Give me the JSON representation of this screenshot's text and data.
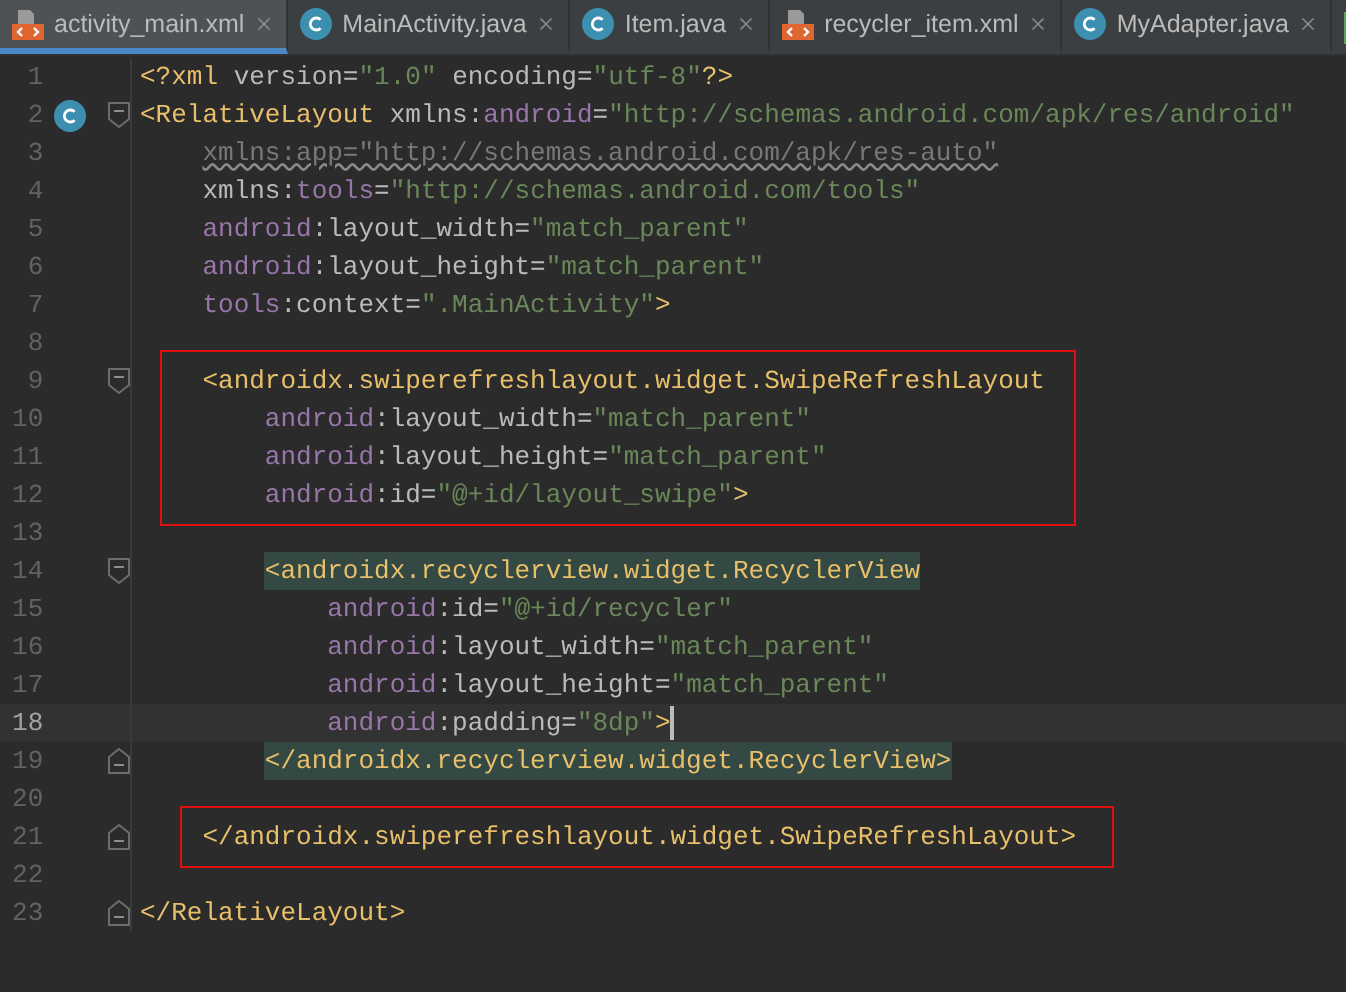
{
  "tabs": [
    {
      "label": "activity_main.xml",
      "kind": "xml",
      "selected": true
    },
    {
      "label": "MainActivity.java",
      "kind": "java",
      "selected": false
    },
    {
      "label": "Item.java",
      "kind": "java",
      "selected": false
    },
    {
      "label": "recycler_item.xml",
      "kind": "xml",
      "selected": false
    },
    {
      "label": "MyAdapter.java",
      "kind": "java",
      "selected": false
    }
  ],
  "editor": {
    "blocks": [
      {
        "kind": "plain",
        "lines": [
          {
            "number": "1",
            "tokens": [
              {
                "kind": "tag",
                "text": "<?xml"
              },
              {
                "kind": "attr",
                "text": " version="
              },
              {
                "kind": "value",
                "text": "\"1.0\""
              },
              {
                "kind": "attr",
                "text": " encoding="
              },
              {
                "kind": "value",
                "text": "\"utf-8\""
              },
              {
                "kind": "tag",
                "text": "?>"
              }
            ]
          },
          {
            "number": "2",
            "class_marker": true,
            "fold_start": true,
            "tokens": [
              {
                "kind": "tag",
                "text": "<RelativeLayout"
              },
              {
                "kind": "attr",
                "text": " xmlns:"
              },
              {
                "kind": "ns",
                "text": "android"
              },
              {
                "kind": "attr",
                "text": "="
              },
              {
                "kind": "value",
                "text": "\"http://schemas.android.com/apk/res/android\""
              }
            ]
          },
          {
            "number": "3",
            "tokens": [
              {
                "kind": "unused",
                "text": "    xmlns:app=\"http://schemas.android.com/apk/res-auto\""
              }
            ]
          },
          {
            "number": "4",
            "tokens": [
              {
                "kind": "attr",
                "text": "    xmlns:"
              },
              {
                "kind": "ns",
                "text": "tools"
              },
              {
                "kind": "attr",
                "text": "="
              },
              {
                "kind": "value",
                "text": "\"http://schemas.android.com/tools\""
              }
            ]
          },
          {
            "number": "5",
            "tokens": [
              {
                "kind": "ns",
                "text": "    android"
              },
              {
                "kind": "attr",
                "text": ":layout_width="
              },
              {
                "kind": "value",
                "text": "\"match_parent\""
              }
            ]
          },
          {
            "number": "6",
            "tokens": [
              {
                "kind": "ns",
                "text": "    android"
              },
              {
                "kind": "attr",
                "text": ":layout_height="
              },
              {
                "kind": "value",
                "text": "\"match_parent\""
              }
            ]
          },
          {
            "number": "7",
            "tokens": [
              {
                "kind": "ns",
                "text": "    tools"
              },
              {
                "kind": "attr",
                "text": ":context="
              },
              {
                "kind": "value",
                "text": "\".MainActivity\""
              },
              {
                "kind": "tag",
                "text": ">"
              }
            ]
          },
          {
            "number": "8"
          }
        ]
      },
      {
        "kind": "framed",
        "lines": [
          {
            "number": "9",
            "fold_start": true,
            "tokens": [
              {
                "kind": "tag",
                "text": "    <androidx.swiperefreshlayout.widget.SwipeRefreshLayout"
              }
            ]
          },
          {
            "number": "10",
            "tokens": [
              {
                "kind": "ns",
                "text": "        android"
              },
              {
                "kind": "attr",
                "text": ":layout_width="
              },
              {
                "kind": "value",
                "text": "\"match_parent\""
              }
            ]
          },
          {
            "number": "11",
            "tokens": [
              {
                "kind": "ns",
                "text": "        android"
              },
              {
                "kind": "attr",
                "text": ":layout_height="
              },
              {
                "kind": "value",
                "text": "\"match_parent\""
              }
            ]
          },
          {
            "number": "12",
            "tokens": [
              {
                "kind": "ns",
                "text": "        android"
              },
              {
                "kind": "attr",
                "text": ":id="
              },
              {
                "kind": "value",
                "text": "\"@+id/layout_swipe\""
              },
              {
                "kind": "tag",
                "text": ">"
              }
            ]
          }
        ]
      },
      {
        "kind": "plain",
        "lines": [
          {
            "number": "13"
          },
          {
            "number": "14",
            "fold_start": true,
            "tokens": [
              {
                "kind": "tag",
                "text": "        <androidx.recyclerview.widget.RecyclerView",
                "matched": true
              }
            ]
          },
          {
            "number": "15",
            "tokens": [
              {
                "kind": "ns",
                "text": "            android"
              },
              {
                "kind": "attr",
                "text": ":id="
              },
              {
                "kind": "value",
                "text": "\"@+id/recycler\""
              }
            ]
          },
          {
            "number": "16",
            "tokens": [
              {
                "kind": "ns",
                "text": "            android"
              },
              {
                "kind": "attr",
                "text": ":layout_width="
              },
              {
                "kind": "value",
                "text": "\"match_parent\""
              }
            ]
          },
          {
            "number": "17",
            "tokens": [
              {
                "kind": "ns",
                "text": "            android"
              },
              {
                "kind": "attr",
                "text": ":layout_height="
              },
              {
                "kind": "value",
                "text": "\"match_parent\""
              }
            ]
          },
          {
            "number": "18",
            "current": true,
            "tokens": [
              {
                "kind": "ns",
                "text": "            android"
              },
              {
                "kind": "attr",
                "text": ":padding="
              },
              {
                "kind": "value",
                "text": "\"8dp\""
              },
              {
                "kind": "tag",
                "text": ">"
              }
            ]
          },
          {
            "number": "19",
            "fold_end": true,
            "tokens": [
              {
                "kind": "tag",
                "text": "        </androidx.recyclerview.widget.RecyclerView>",
                "matched": true
              }
            ]
          },
          {
            "number": "20"
          }
        ]
      },
      {
        "kind": "framed",
        "lines": [
          {
            "number": "21",
            "fold_end": true,
            "tokens": [
              {
                "kind": "tag",
                "text": "    </androidx.swiperefreshlayout.widget.SwipeRefreshLayout>"
              }
            ]
          }
        ]
      },
      {
        "kind": "plain",
        "lines": [
          {
            "number": "22"
          },
          {
            "number": "23",
            "fold_end": true,
            "tokens": [
              {
                "kind": "tag",
                "text": "</RelativeLayout>"
              }
            ]
          }
        ]
      }
    ]
  }
}
